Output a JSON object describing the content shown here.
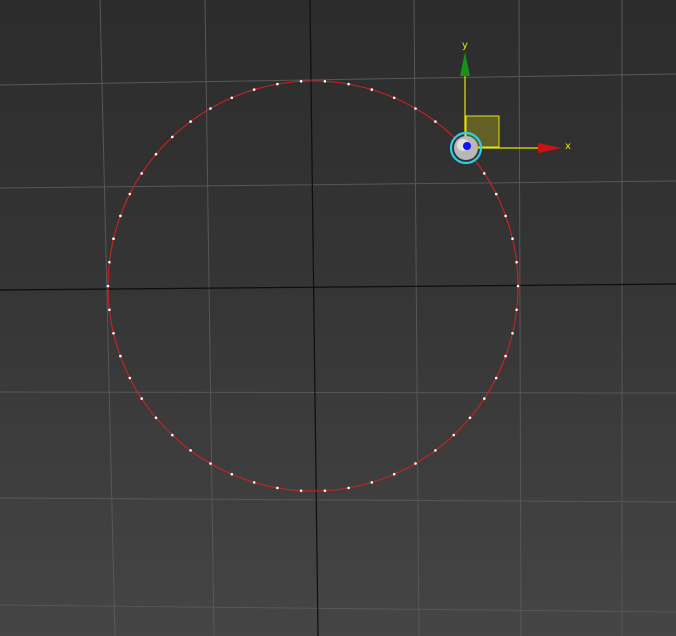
{
  "viewport": {
    "name": "perspective-viewport",
    "colors": {
      "grid": "#565656",
      "world_axis": "#0a0a0a",
      "circle": "#cc2222",
      "vertex": "#ffffff",
      "gizmo_x": "#cc1111",
      "gizmo_y": "#1a8f1a",
      "gizmo_stem": "#e6e600",
      "gizmo_plane": "#6e6a22",
      "gizmo_center_ring": "#2ad0ea",
      "gizmo_center": "#1111ee"
    },
    "gizmo": {
      "x_label": "x",
      "y_label": "y",
      "icons": [
        "move-transform-gizmo-icon",
        "pivot-point-icon"
      ]
    }
  }
}
